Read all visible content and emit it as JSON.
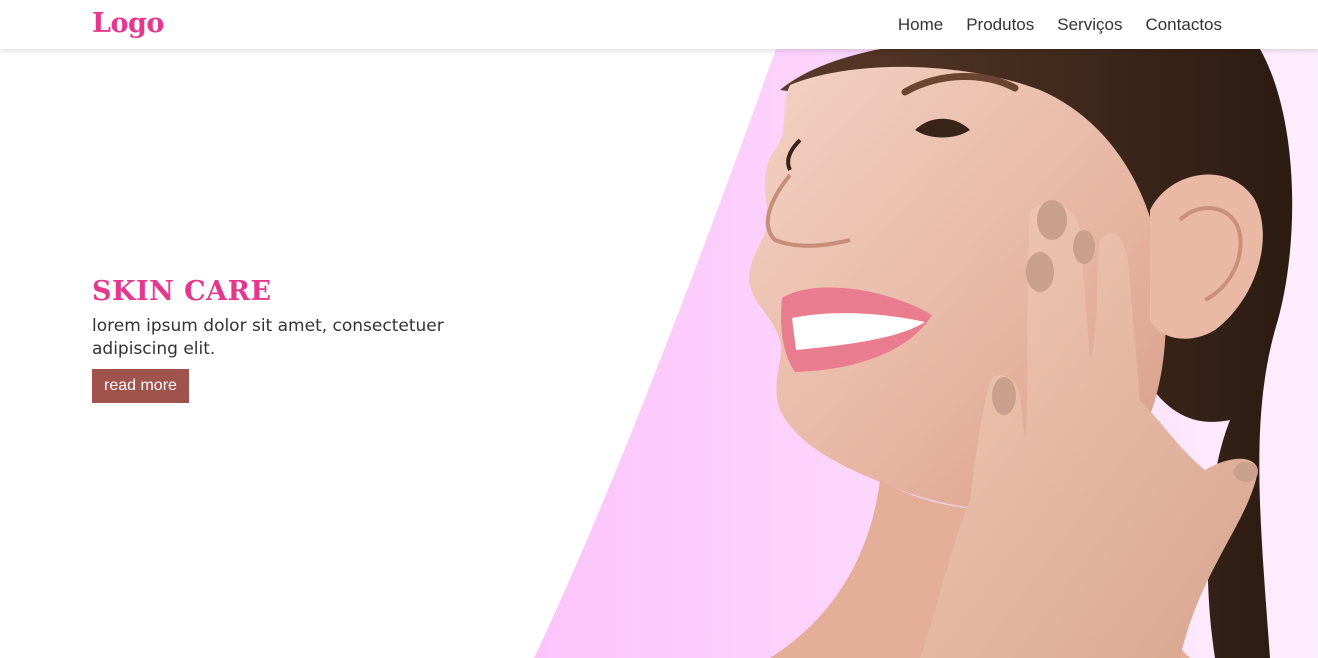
{
  "nav": {
    "logo": "Logo",
    "links": [
      "Home",
      "Produtos",
      "Serviços",
      "Contactos"
    ]
  },
  "hero": {
    "title": "SKIN CARE",
    "description": "lorem ipsum dolor sit amet, consectetuer adipiscing elit.",
    "button_label": "read more"
  },
  "colors": {
    "brand_pink": "#e6378f",
    "backdrop_pink": "#fcc4fb",
    "button": "#a0524d",
    "text": "#333333"
  }
}
